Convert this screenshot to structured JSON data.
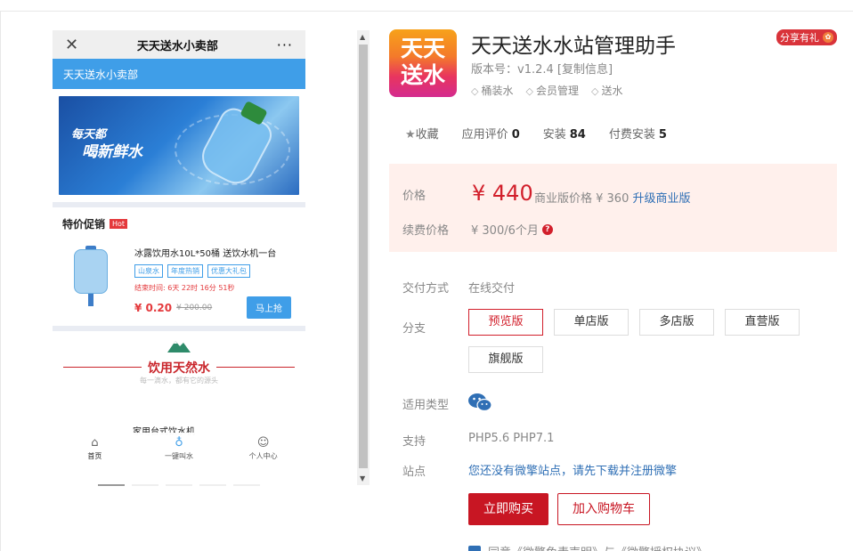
{
  "phone": {
    "nav_title": "天天送水小卖部",
    "close_glyph": "✕",
    "more_glyph": "···",
    "shop_bar": "天天送水小卖部",
    "banner_line1": "每天都",
    "banner_line2": "喝新鲜水",
    "promo_title": "特价促销",
    "hot_label": "Hot",
    "product": {
      "name": "冰露饮用水10L*50桶 送饮水机一台",
      "tags": [
        "山泉水",
        "年度热销",
        "优惠大礼包"
      ],
      "countdown": "结束时间:  6天 22时 16分 51秒",
      "price": "¥ 0.20",
      "old_price": "¥ 200.00",
      "buy_label": "马上抢"
    },
    "section_title": "饮用天然水",
    "section_sub": "每一滴水，都有它的源头",
    "next_item": "家用台式饮水机",
    "tabs": [
      {
        "icon": "home-icon",
        "label": "首页"
      },
      {
        "icon": "bike-icon",
        "label": "一键叫水"
      },
      {
        "icon": "user-icon",
        "label": "个人中心"
      }
    ]
  },
  "app": {
    "icon_text1": "天天",
    "icon_text2": "送水",
    "title": "天天送水水站管理助手",
    "share_label": "分享有礼",
    "version": "版本号：v1.2.4",
    "copy_info": "[复制信息]",
    "tags": [
      "桶装水",
      "会员管理",
      "送水"
    ]
  },
  "stats": {
    "favorite": "收藏",
    "rating_label": "应用评价",
    "rating_value": "0",
    "install_label": "安装",
    "install_value": "84",
    "paid_label": "付费安装",
    "paid_value": "5"
  },
  "pricing": {
    "price_label": "价格",
    "price": "¥ 440",
    "biz_text": "商业版价格 ¥ 360",
    "upgrade_link": "升级商业版",
    "renew_label": "续费价格",
    "renew_value": "¥ 300/6个月"
  },
  "details": {
    "delivery_label": "交付方式",
    "delivery_value": "在线交付",
    "branch_label": "分支",
    "branches": [
      "预览版",
      "单店版",
      "多店版",
      "直营版",
      "旗舰版"
    ],
    "type_label": "适用类型",
    "support_label": "支持",
    "support_value": "PHP5.6 PHP7.1",
    "site_label": "站点",
    "site_link": "您还没有微擎站点，请先下载并注册微擎"
  },
  "actions": {
    "buy_now": "立即购买",
    "add_cart": "加入购物车",
    "agree_text": "同意《微擎免责声明》与《微擎授权协议》"
  },
  "colors": {
    "accent_red": "#d21f2b",
    "phone_blue": "#3f9ee8",
    "link_blue": "#2f6fb5"
  }
}
